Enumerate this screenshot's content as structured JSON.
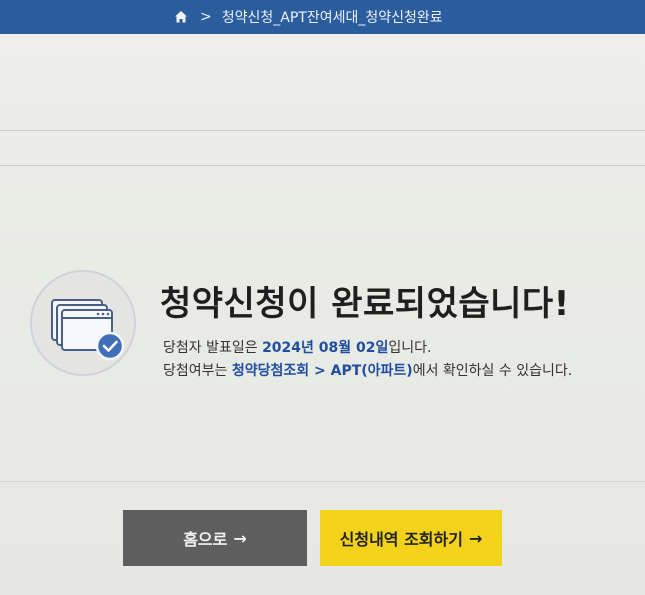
{
  "breadcrumb": {
    "separator": ">",
    "current": "청약신청_APT잔여세대_청약신청완료"
  },
  "result": {
    "title": "청약신청이 완료되었습니다!",
    "announce_prefix": "당첨자 발표일은 ",
    "announce_date": "2024년 08월 02일",
    "announce_suffix": "입니다.",
    "check_prefix": "당첨여부는 ",
    "check_link": "청약당첨조회 > APT(아파트)",
    "check_suffix": "에서 확인하실 수 있습니다."
  },
  "buttons": {
    "home_label": "홈으로",
    "history_label": "신청내역 조회하기",
    "arrow": "→"
  },
  "icons": {
    "breadcrumb_home": "home-icon",
    "completion": "browser-windows-check-icon"
  },
  "colors": {
    "topbar": "#2b5c9e",
    "highlight": "#1f4ea0",
    "home_button": "#5e5e5e",
    "history_button": "#f2d21a",
    "check_badge": "#3f6fb8"
  }
}
